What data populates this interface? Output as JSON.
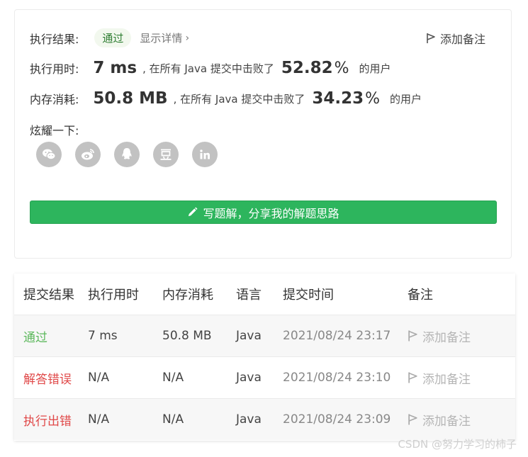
{
  "summary": {
    "result_label": "执行结果:",
    "result_value": "通过",
    "detail_link": "显示详情",
    "add_note": "添加备注",
    "runtime_label": "执行用时:",
    "runtime_value": "7 ms",
    "beat_text": ", 在所有 Java 提交中击败了",
    "runtime_percent": "52.82",
    "percent_symbol": "%",
    "users_text": "的用户",
    "memory_label": "内存消耗:",
    "memory_value": "50.8 MB",
    "memory_percent": "34.23",
    "share_label": "炫耀一下:",
    "share_icons": [
      "wechat-icon",
      "weibo-icon",
      "qq-icon",
      "douban-icon",
      "linkedin-icon"
    ],
    "write_button": "写题解，分享我的解题思路"
  },
  "table": {
    "headers": [
      "提交结果",
      "执行用时",
      "内存消耗",
      "语言",
      "提交时间",
      "备注"
    ],
    "rows": [
      {
        "status": "通过",
        "runtime": "7 ms",
        "memory": "50.8 MB",
        "language": "Java",
        "time": "2021/08/24 23:17",
        "note": "添加备注"
      },
      {
        "status": "解答错误",
        "runtime": "N/A",
        "memory": "N/A",
        "language": "Java",
        "time": "2021/08/24 23:10",
        "note": "添加备注"
      },
      {
        "status": "执行出错",
        "runtime": "N/A",
        "memory": "N/A",
        "language": "Java",
        "time": "2021/08/24 23:09",
        "note": "添加备注"
      }
    ]
  },
  "watermark": "CSDN @努力学习的柿子",
  "colors": {
    "accent_green": "#2db55d",
    "pass_green": "#5cb85c",
    "error_red": "#e04848"
  }
}
